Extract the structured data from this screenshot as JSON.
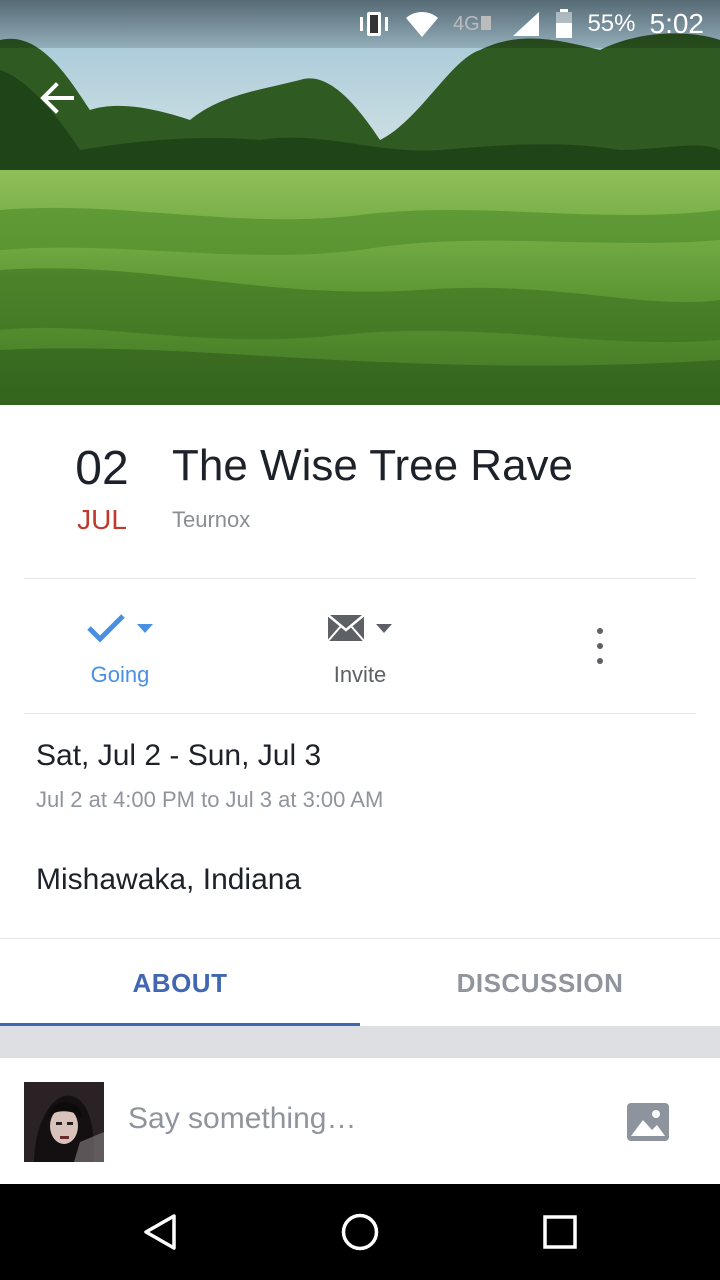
{
  "status_bar": {
    "battery_percent": "55%",
    "time": "5:02",
    "network": "4G",
    "icons": [
      "vibrate-icon",
      "wifi-icon",
      "lte-icon",
      "signal-icon",
      "battery-icon"
    ]
  },
  "cover": {
    "image": "meadow-landscape",
    "back_icon": "back-arrow-icon"
  },
  "event": {
    "day": "02",
    "month": "JUL",
    "title": "The Wise Tree Rave",
    "host": "Teurnox"
  },
  "actions": {
    "going_label": "Going",
    "invite_label": "Invite",
    "more_icon": "more-vertical-icon"
  },
  "details": {
    "date_range": "Sat, Jul 2 - Sun, Jul 3",
    "time_range": "Jul 2 at 4:00 PM to Jul 3 at 3:00 AM",
    "location": "Mishawaka, Indiana"
  },
  "tabs": [
    {
      "label": "ABOUT",
      "active": true
    },
    {
      "label": "DISCUSSION",
      "active": false
    }
  ],
  "composer": {
    "placeholder": "Say something…"
  },
  "colors": {
    "accent": "#4267b2",
    "going": "#4a90e2",
    "month": "#c0392b"
  }
}
